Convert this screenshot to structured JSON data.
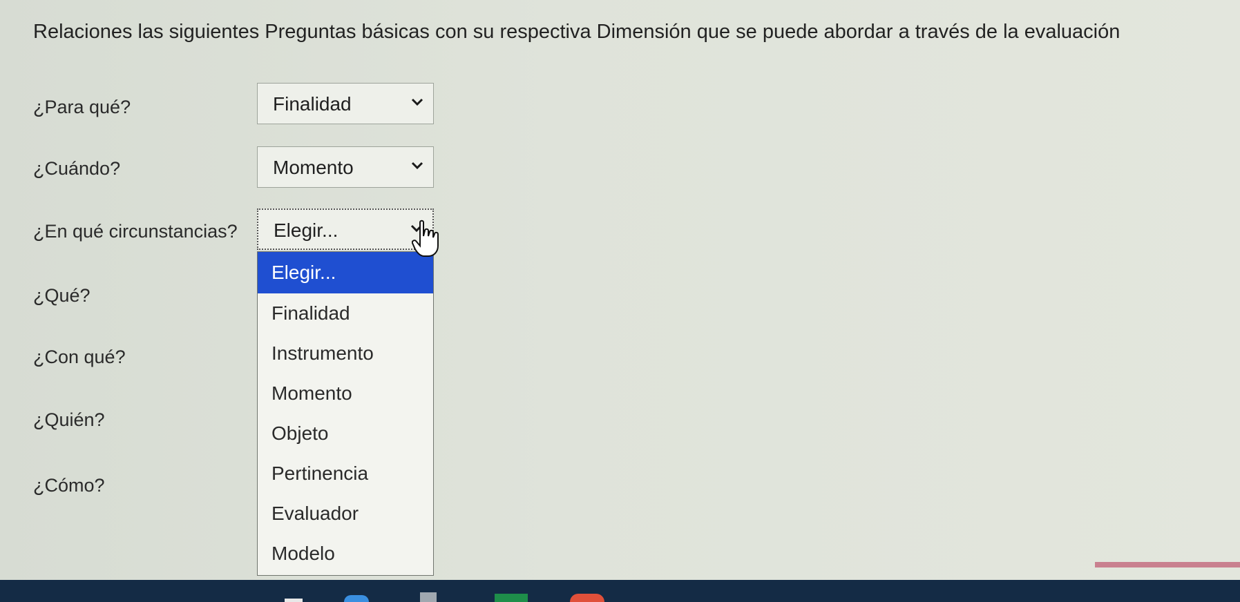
{
  "instruction": "Relaciones las siguientes Preguntas básicas con su respectiva Dimensión que se puede abordar a través de la evaluación",
  "questions": [
    {
      "label": "¿Para qué?",
      "selected": "Finalidad"
    },
    {
      "label": "¿Cuándo?",
      "selected": "Momento"
    },
    {
      "label": "¿En qué circunstancias?",
      "selected": "Elegir..."
    },
    {
      "label": "¿Qué?"
    },
    {
      "label": "¿Con qué?"
    },
    {
      "label": "¿Quién?"
    },
    {
      "label": "¿Cómo?"
    }
  ],
  "dropdown_options": [
    "Elegir...",
    "Finalidad",
    "Instrumento",
    "Momento",
    "Objeto",
    "Pertinencia",
    "Evaluador",
    "Modelo"
  ],
  "dropdown_highlighted": "Elegir...",
  "colors": {
    "highlight": "#1f4fd1",
    "taskbar": "#142b45"
  },
  "icons": [
    "chevron-down-icon",
    "hand-pointer-cursor-icon"
  ]
}
